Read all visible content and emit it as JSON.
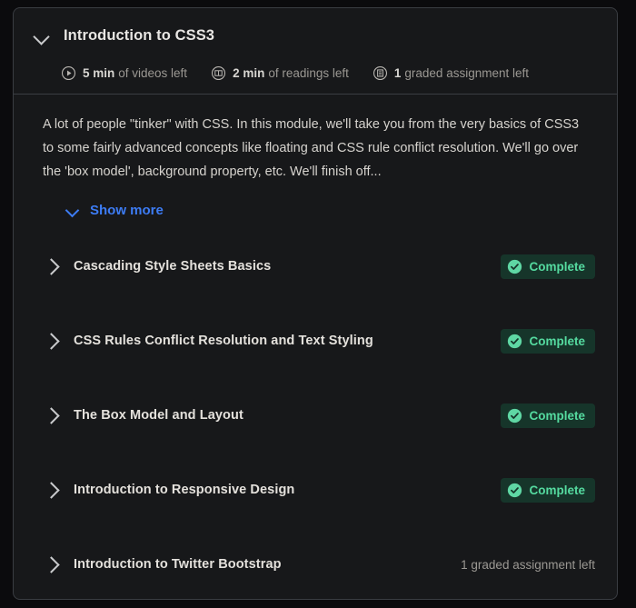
{
  "module": {
    "title": "Introduction to CSS3",
    "expanded": true,
    "collapse_icon": "chevron-down-icon",
    "meta": [
      {
        "icon": "video-play-icon",
        "value": "5 min",
        "label": "of videos left"
      },
      {
        "icon": "reading-book-icon",
        "value": "2 min",
        "label": "of readings left"
      },
      {
        "icon": "graded-assignment-icon",
        "value": "1",
        "label": "graded assignment left"
      }
    ],
    "description": "A lot of people \"tinker\" with CSS. In this module, we'll take you from the very basics of CSS3 to some fairly advanced concepts like floating and CSS rule conflict resolution. We'll go over the 'box model', background property, etc. We'll finish off...",
    "show_more": {
      "label": "Show more",
      "icon": "chevron-down-icon"
    },
    "lessons": [
      {
        "title": "Cascading Style Sheets Basics",
        "expand_icon": "chevron-right-icon",
        "status_type": "badge",
        "status_label": "Complete",
        "status_icon": "check-circle-icon"
      },
      {
        "title": "CSS Rules Conflict Resolution and Text Styling",
        "expand_icon": "chevron-right-icon",
        "status_type": "badge",
        "status_label": "Complete",
        "status_icon": "check-circle-icon"
      },
      {
        "title": "The Box Model and Layout",
        "expand_icon": "chevron-right-icon",
        "status_type": "badge",
        "status_label": "Complete",
        "status_icon": "check-circle-icon"
      },
      {
        "title": "Introduction to Responsive Design",
        "expand_icon": "chevron-right-icon",
        "status_type": "badge",
        "status_label": "Complete",
        "status_icon": "check-circle-icon"
      },
      {
        "title": "Introduction to Twitter Bootstrap",
        "expand_icon": "chevron-right-icon",
        "status_type": "text",
        "status_label": "1 graded assignment left",
        "status_icon": ""
      }
    ]
  },
  "colors": {
    "page_background": "#0b0b0d",
    "card_background": "#17181a",
    "card_border": "#3a3d42",
    "title_text": "#e8e6e3",
    "body_text": "#d6d3ce",
    "muted_text": "#9b9893",
    "link_blue": "#3d7cf4",
    "complete_green": "#55dba0",
    "complete_badge_bg": "#16352a"
  }
}
